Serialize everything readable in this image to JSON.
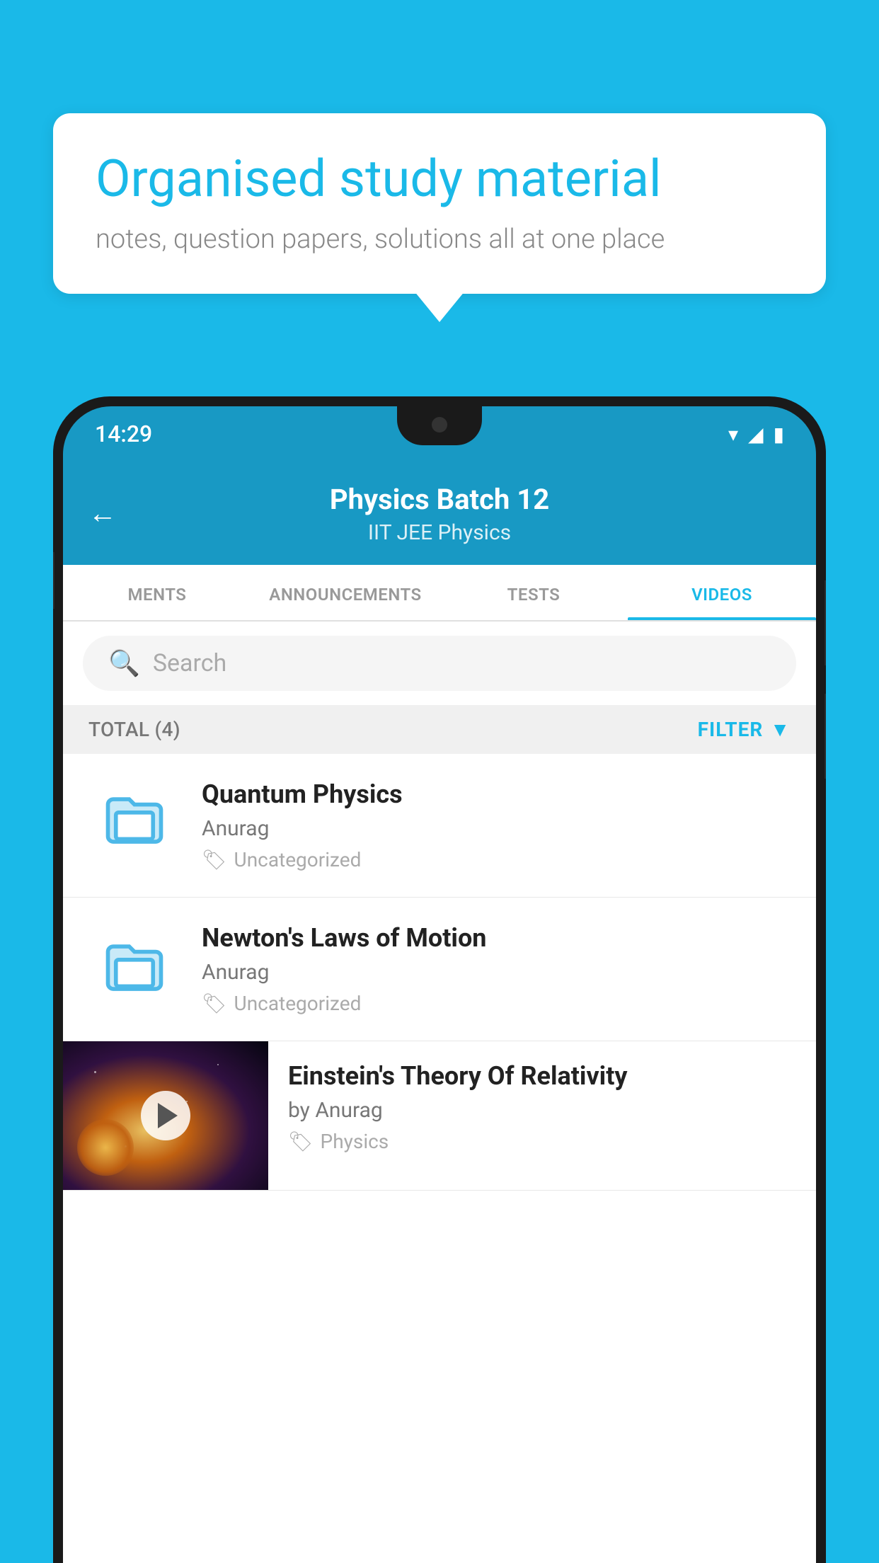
{
  "bubble": {
    "title": "Organised study material",
    "subtitle": "notes, question papers, solutions all at one place"
  },
  "status_bar": {
    "time": "14:29",
    "wifi": "▾",
    "signal": "▲",
    "battery": "▮"
  },
  "header": {
    "title": "Physics Batch 12",
    "subtitle": "IIT JEE    Physics",
    "back_label": "←"
  },
  "tabs": [
    {
      "label": "MENTS",
      "active": false
    },
    {
      "label": "ANNOUNCEMENTS",
      "active": false
    },
    {
      "label": "TESTS",
      "active": false
    },
    {
      "label": "VIDEOS",
      "active": true
    }
  ],
  "search": {
    "placeholder": "Search"
  },
  "filter": {
    "total_label": "TOTAL (4)",
    "filter_label": "FILTER"
  },
  "videos": [
    {
      "title": "Quantum Physics",
      "author": "Anurag",
      "tag": "Uncategorized",
      "type": "folder"
    },
    {
      "title": "Newton's Laws of Motion",
      "author": "Anurag",
      "tag": "Uncategorized",
      "type": "folder"
    },
    {
      "title": "Einstein's Theory Of Relativity",
      "author": "by Anurag",
      "tag": "Physics",
      "type": "video"
    }
  ]
}
